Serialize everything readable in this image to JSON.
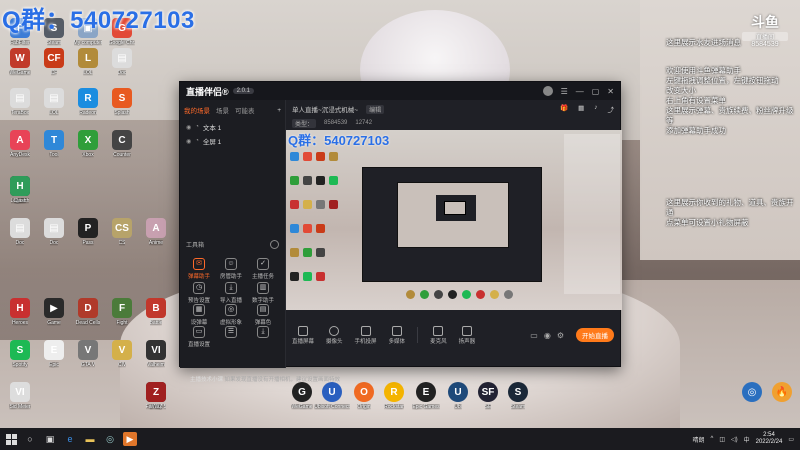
{
  "overlay_title": "Q群：540727103",
  "desktop_icons": [
    {
      "label": "FabFilter",
      "color": "#3c7cd6",
      "glyph": "F"
    },
    {
      "label": "Steam",
      "color": "#555c66",
      "glyph": "S"
    },
    {
      "label": "My computer",
      "color": "#8aa5c6",
      "glyph": "▣"
    },
    {
      "label": "Google Chr.",
      "color": "#e24a36",
      "glyph": "G"
    },
    {
      "label": "WeGame",
      "color": "#c13a2a",
      "glyph": "W"
    },
    {
      "label": "CF",
      "color": "#c93b18",
      "glyph": "CF"
    },
    {
      "label": "LOL",
      "color": "#b28b3a",
      "glyph": "L"
    },
    {
      "label": "Doc",
      "color": "#dcdcdc",
      "glyph": "▤"
    },
    {
      "label": "TeraBox",
      "color": "#dcdcdc",
      "glyph": "▤"
    },
    {
      "label": "LOL",
      "color": "#dcdcdc",
      "glyph": "▤"
    },
    {
      "label": "Radeon",
      "color": "#1b8de0",
      "glyph": "R"
    },
    {
      "label": "Splash",
      "color": "#e85a20",
      "glyph": "S"
    },
    {
      "label": "AnyDesk",
      "color": "#e84357",
      "glyph": "A"
    },
    {
      "label": "Tool",
      "color": "#2f88d8",
      "glyph": "T"
    },
    {
      "label": "Xbox",
      "color": "#2f9e3a",
      "glyph": "X"
    },
    {
      "label": "Counter",
      "color": "#444",
      "glyph": "C"
    },
    {
      "label": "Logitech",
      "color": "#222",
      "glyph": "G"
    },
    {
      "label": "Clash",
      "color": "#2f9c5a",
      "glyph": "H"
    },
    {
      "label": "Doc",
      "color": "#dcdcdc",
      "glyph": "▤"
    },
    {
      "label": "Doc",
      "color": "#dcdcdc",
      "glyph": "▤"
    },
    {
      "label": "Pass",
      "color": "#222",
      "glyph": "P"
    },
    {
      "label": "CS",
      "color": "#b7a36a",
      "glyph": "CS"
    },
    {
      "label": "Anime",
      "color": "#c8a0b0",
      "glyph": "A"
    },
    {
      "label": "Heroes",
      "color": "#c83030",
      "glyph": "H"
    },
    {
      "label": "Game",
      "color": "#2a2a2a",
      "glyph": "▶"
    },
    {
      "label": "Dead Cells",
      "color": "#b03a2a",
      "glyph": "D"
    },
    {
      "label": "Fight",
      "color": "#4b7b3a",
      "glyph": "F"
    },
    {
      "label": "Battle",
      "color": "#c2382c",
      "glyph": "B"
    },
    {
      "label": "Spotify",
      "color": "#1db954",
      "glyph": "S"
    },
    {
      "label": "Epic",
      "color": "#eee",
      "glyph": "E"
    },
    {
      "label": "GTA V",
      "color": "#777",
      "glyph": "V"
    },
    {
      "label": "CIV",
      "color": "#d4b04a",
      "glyph": "V"
    },
    {
      "label": "Valheim",
      "color": "#333",
      "glyph": "VI"
    },
    {
      "label": "Sid Meier",
      "color": "#ddd",
      "glyph": "VI"
    },
    {
      "label": "Far Cry 5",
      "color": "#333",
      "glyph": "5"
    },
    {
      "label": "WWZ",
      "color": "#a02020",
      "glyph": "Z"
    }
  ],
  "dock_icons": [
    {
      "label": "WeGame",
      "color": "#222",
      "glyph": "G"
    },
    {
      "label": "Ubisoft Connect",
      "color": "#2a5fbf",
      "glyph": "U"
    },
    {
      "label": "Origin",
      "color": "#f06a22",
      "glyph": "O"
    },
    {
      "label": "Rockstar",
      "color": "#f4b400",
      "glyph": "R"
    },
    {
      "label": "Epic Games",
      "color": "#222",
      "glyph": "E"
    },
    {
      "label": "Ubi",
      "color": "#1f4a7a",
      "glyph": "U"
    },
    {
      "label": "SE",
      "color": "#223",
      "glyph": "SF"
    },
    {
      "label": "Steam",
      "color": "#1b2838",
      "glyph": "S"
    }
  ],
  "right_overlay": {
    "room_label": "直播间",
    "room_number": "8584539",
    "info_top": "这里展示水友进场消息",
    "info_mid": "欢迎使用斗鱼弹幕助手\n左键拖拽调整位置，左键按钮拖动\n改变大小\n右上角有设置菜单\n这里展示弹幕、贵族续费、粉丝牌升级等\n添加弹幕助手成功",
    "info_bottom": "这里展示你收到的礼物、道具、贵族开通\n点菜单可设置小礼物屏蔽"
  },
  "app": {
    "brand": "直播伴侣®",
    "version": "2.0.1",
    "tabs": [
      "我的场景",
      "场景",
      "可能表"
    ],
    "layers": [
      "文本 1",
      "全屏 1"
    ],
    "tools_header": "工具箱",
    "tools": [
      {
        "label": "弹幕助手",
        "glyph": "✉",
        "active": true
      },
      {
        "label": "房管助手",
        "glyph": "☺",
        "active": false
      },
      {
        "label": "主播任务",
        "glyph": "✓",
        "active": false
      },
      {
        "label": "预告设置",
        "glyph": "◷",
        "active": false
      },
      {
        "label": "导入直播",
        "glyph": "⤓",
        "active": false
      },
      {
        "label": "数字助手",
        "glyph": "▥",
        "active": false
      },
      {
        "label": "设弹幕",
        "glyph": "▦",
        "active": false
      },
      {
        "label": "虚拟形象",
        "glyph": "◎",
        "active": false
      },
      {
        "label": "弹幕色",
        "glyph": "▤",
        "active": false
      },
      {
        "label": "直播设置",
        "glyph": "▭",
        "active": false
      },
      {
        "label": "",
        "glyph": "☰",
        "active": false
      },
      {
        "label": "",
        "glyph": "⤓",
        "active": false
      }
    ],
    "bottom_tip_label": "主播技术小课",
    "bottom_tip": "如果发现直播没有开播相机，建议设置画面特效",
    "header_title": "单人直播~沉浸式机械~",
    "header_tag": "编辑",
    "header_sub": "类型：",
    "header_room": "8584539",
    "header_count": "12742",
    "preview_qq": "Q群：540727103",
    "controls": [
      "直播屏幕",
      "摄像头",
      "手机投屏",
      "多媒体",
      "麦克风",
      "扬声器"
    ],
    "start_label": "开始直播",
    "accent": "#ff6a2a"
  },
  "taskbar": {
    "time": "2:54",
    "date": "2022/2/24",
    "lang": "中",
    "tray_text": "晴朗"
  }
}
